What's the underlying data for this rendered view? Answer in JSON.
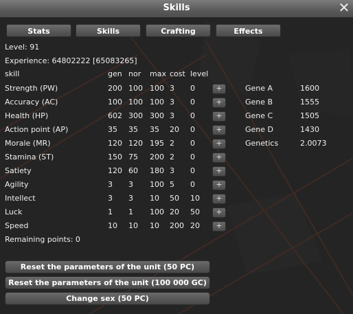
{
  "window": {
    "title": "Skills"
  },
  "tabs": [
    "Stats",
    "Skills",
    "Crafting",
    "Effects"
  ],
  "info": {
    "level": "Level: 91",
    "experience": "Experience: 64802222 [65083265]"
  },
  "headers": [
    "skill",
    "gen",
    "nor",
    "max",
    "cost",
    "level"
  ],
  "skills": [
    {
      "name": "Strength (PW)",
      "gen": "200",
      "nor": "100",
      "max": "100",
      "cost": "3",
      "level": "0"
    },
    {
      "name": "Accuracy (AC)",
      "gen": "100",
      "nor": "100",
      "max": "100",
      "cost": "3",
      "level": "0"
    },
    {
      "name": "Health (HP)",
      "gen": "602",
      "nor": "300",
      "max": "300",
      "cost": "3",
      "level": "0"
    },
    {
      "name": "Action point (AP)",
      "gen": "35",
      "nor": "35",
      "max": "35",
      "cost": "20",
      "level": "0"
    },
    {
      "name": "Morale (MR)",
      "gen": "120",
      "nor": "120",
      "max": "195",
      "cost": "2",
      "level": "0"
    },
    {
      "name": "Stamina (ST)",
      "gen": "150",
      "nor": "75",
      "max": "200",
      "cost": "2",
      "level": "0"
    },
    {
      "name": "Satiety",
      "gen": "120",
      "nor": "60",
      "max": "180",
      "cost": "3",
      "level": "0"
    },
    {
      "name": "Agility",
      "gen": "3",
      "nor": "3",
      "max": "100",
      "cost": "5",
      "level": "0"
    },
    {
      "name": "Intellect",
      "gen": "3",
      "nor": "3",
      "max": "10",
      "cost": "50",
      "level": "10"
    },
    {
      "name": "Luck",
      "gen": "1",
      "nor": "1",
      "max": "100",
      "cost": "20",
      "level": "50"
    },
    {
      "name": "Speed",
      "gen": "10",
      "nor": "10",
      "max": "10",
      "cost": "200",
      "level": "20"
    }
  ],
  "plus_label": "+",
  "genes": [
    {
      "name": "Gene A",
      "value": "1600"
    },
    {
      "name": "Gene B",
      "value": "1555"
    },
    {
      "name": "Gene C",
      "value": "1505"
    },
    {
      "name": "Gene D",
      "value": "1430"
    },
    {
      "name": "Genetics",
      "value": "2.0073"
    }
  ],
  "remaining": "Remaining points: 0",
  "buttons": [
    "Reset the parameters of the unit (50 PC)",
    "Reset the parameters of the unit (100 000 GC)",
    "Change sex (50 PC)"
  ],
  "colors": {
    "background_line": "#b0462a",
    "panel": "#222222",
    "button": "#5a5a5a"
  },
  "icons": {
    "close": "close-icon"
  }
}
